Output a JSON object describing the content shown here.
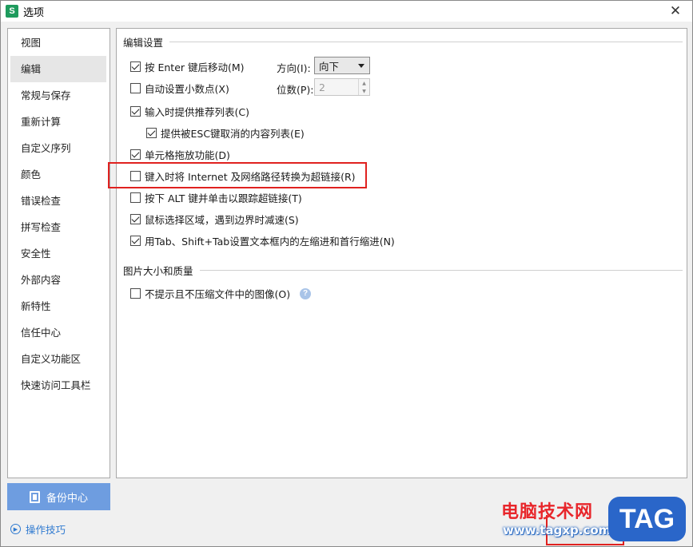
{
  "window": {
    "title": "选项",
    "app_icon_letter": "S",
    "close_glyph": "✕"
  },
  "sidebar": {
    "items": [
      {
        "label": "视图"
      },
      {
        "label": "编辑"
      },
      {
        "label": "常规与保存"
      },
      {
        "label": "重新计算"
      },
      {
        "label": "自定义序列"
      },
      {
        "label": "颜色"
      },
      {
        "label": "错误检查"
      },
      {
        "label": "拼写检查"
      },
      {
        "label": "安全性"
      },
      {
        "label": "外部内容"
      },
      {
        "label": "新特性"
      },
      {
        "label": "信任中心"
      },
      {
        "label": "自定义功能区"
      },
      {
        "label": "快速访问工具栏"
      }
    ],
    "active_index": 1,
    "backup_button_label": "备份中心",
    "tips_label": "操作技巧"
  },
  "edit_section": {
    "title": "编辑设置",
    "options": [
      {
        "label": "按 Enter 键后移动(M)",
        "checked": true
      },
      {
        "label": "自动设置小数点(X)",
        "checked": false
      },
      {
        "label": "输入时提供推荐列表(C)",
        "checked": true
      },
      {
        "label": "提供被ESC键取消的内容列表(E)",
        "checked": true
      },
      {
        "label": "单元格拖放功能(D)",
        "checked": true
      },
      {
        "label": "键入时将 Internet 及网络路径转换为超链接(R)",
        "checked": false
      },
      {
        "label": "按下 ALT 键并单击以跟踪超链接(T)",
        "checked": false
      },
      {
        "label": "鼠标选择区域，遇到边界时减速(S)",
        "checked": true
      },
      {
        "label": "用Tab、Shift+Tab设置文本框内的左缩进和首行缩进(N)",
        "checked": true
      }
    ],
    "direction_label": "方向(I):",
    "direction_value": "向下",
    "places_label": "位数(P):",
    "places_value": "2"
  },
  "image_section": {
    "title": "图片大小和质量",
    "options": [
      {
        "label": "不提示且不压缩文件中的图像(O)",
        "checked": false
      }
    ],
    "help_glyph": "?"
  },
  "watermark": {
    "site_name": "电脑技术网",
    "site_url": "www.tagxp.com",
    "tag_label": "TAG"
  },
  "colors": {
    "accent": "#6e9de0",
    "highlight_border": "#e0211f",
    "link": "#2f7ad0"
  }
}
